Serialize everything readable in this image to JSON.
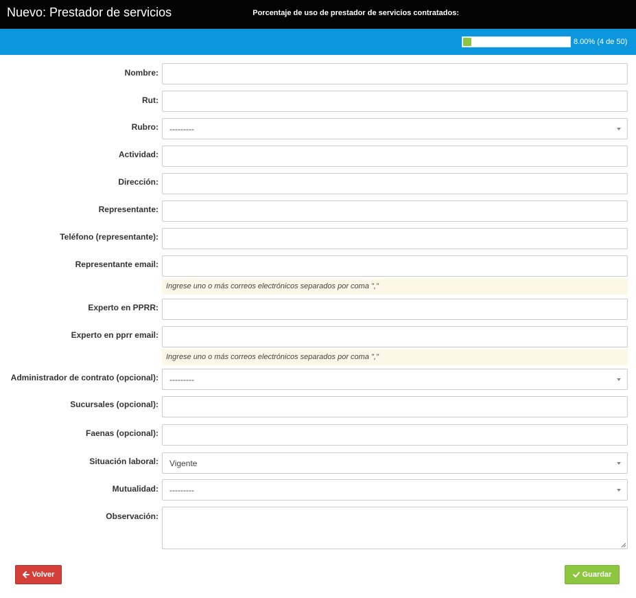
{
  "window": {
    "title": "Nuevo: Prestador de servicios"
  },
  "usage": {
    "label": "Porcentaje de uso de prestador de servicios contratados:",
    "value_text": "8.00% (4 de 50)",
    "fraction": 0.08,
    "bar_color": "#8cc63f",
    "banner_color": "#0b96dd"
  },
  "form": {
    "nombre": {
      "label": "Nombre:",
      "value": ""
    },
    "rut": {
      "label": "Rut:",
      "value": ""
    },
    "rubro": {
      "label": "Rubro:",
      "value": "---------"
    },
    "actividad": {
      "label": "Actividad:",
      "value": ""
    },
    "direccion": {
      "label": "Dirección:",
      "value": ""
    },
    "representante": {
      "label": "Representante:",
      "value": ""
    },
    "telefono": {
      "label": "Teléfono (representante):",
      "value": ""
    },
    "rep_email": {
      "label": "Representante email:",
      "value": "",
      "help": "Ingrese uno o más correos electrónicos separados por coma \",\""
    },
    "experto": {
      "label": "Experto en PPRR:",
      "value": ""
    },
    "experto_email": {
      "label": "Experto en pprr email:",
      "value": "",
      "help": "Ingrese uno o más correos electrónicos separados por coma \",\""
    },
    "administrador": {
      "label": "Administrador de contrato (opcional):",
      "value": "---------"
    },
    "sucursales": {
      "label": "Sucursales (opcional):",
      "value": ""
    },
    "faenas": {
      "label": "Faenas (opcional):",
      "value": ""
    },
    "situacion": {
      "label": "Situación laboral:",
      "value": "Vigente"
    },
    "mutualidad": {
      "label": "Mutualidad:",
      "value": "---------"
    },
    "observacion": {
      "label": "Observación:",
      "value": ""
    }
  },
  "buttons": {
    "back": {
      "label": "Volver",
      "icon": "arrow-left-icon",
      "color": "#d43f3a"
    },
    "save": {
      "label": "Guardar",
      "icon": "check-icon",
      "color": "#8cc63f"
    }
  }
}
